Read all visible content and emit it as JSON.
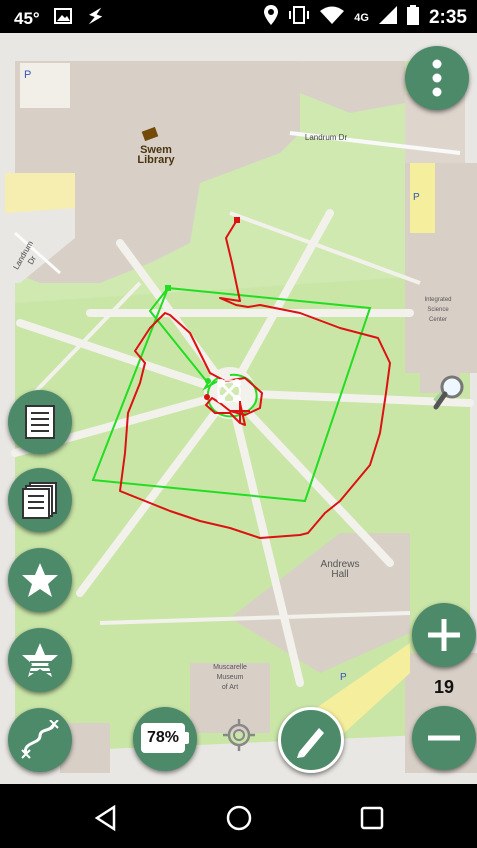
{
  "status_bar": {
    "temperature": "45°",
    "network": "4G",
    "time": "2:35"
  },
  "map": {
    "labels": {
      "library": "Swem\nLibrary",
      "landrum": "Landrum Dr",
      "landrum_side": "Landrum Dr",
      "integrated_science": "Integrated\nScience\nCenter",
      "andrews": "Andrews\nHall",
      "muscarelle": "Muscarelle\nMuseum\nof Art",
      "parking_1": "P",
      "parking_2": "P",
      "parking_3": "P"
    }
  },
  "controls": {
    "battery_percent": "78%",
    "zoom_level": "19"
  },
  "colors": {
    "fab": "#4d8a6a",
    "flight_path": "#dd1111",
    "mission_area": "#22dd22"
  },
  "icons": {
    "menu": "vertical-dots-icon",
    "search": "magnifier-icon",
    "list": "list-icon",
    "layers": "layers-icon",
    "star": "star-icon",
    "star_list": "star-list-icon",
    "path": "path-icon",
    "locate": "crosshair-icon",
    "draw": "pencil-icon",
    "zoom_in": "plus-icon",
    "zoom_out": "minus-icon"
  }
}
